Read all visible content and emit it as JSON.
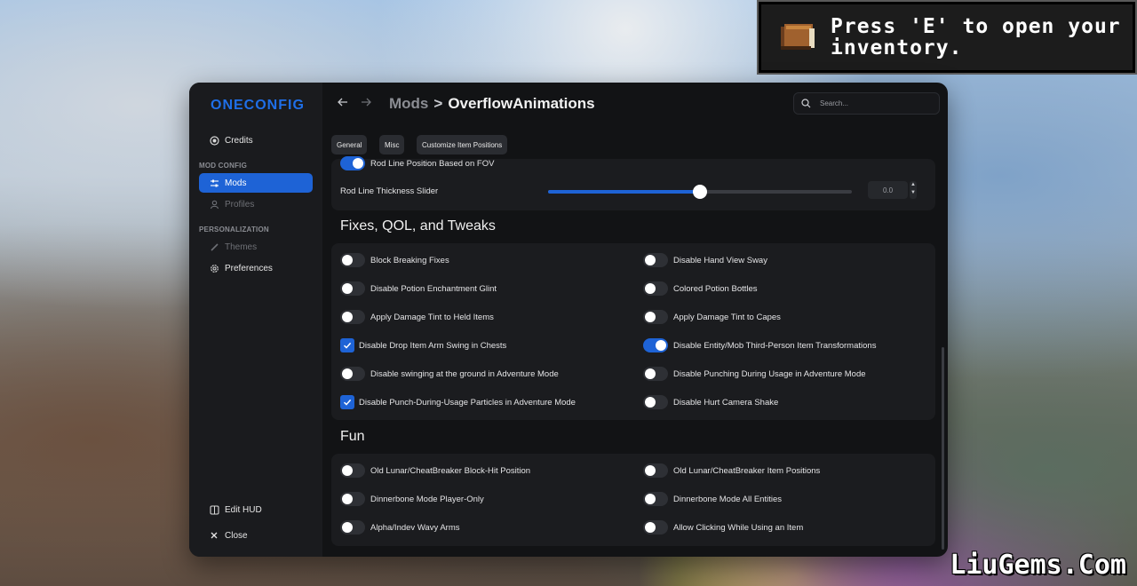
{
  "toast": {
    "message": "Press 'E' to open your inventory."
  },
  "watermark": "LiuGems.Com",
  "sidebar": {
    "logo": "ONECONFIG",
    "credits": "Credits",
    "mod_config_heading": "MOD CONFIG",
    "mods": "Mods",
    "profiles": "Profiles",
    "personalization_heading": "PERSONALIZATION",
    "themes": "Themes",
    "preferences": "Preferences",
    "edit_hud": "Edit HUD",
    "close": "Close"
  },
  "header": {
    "breadcrumb_parent": "Mods",
    "breadcrumb_separator": ">",
    "breadcrumb_current": "OverflowAnimations",
    "search_placeholder": "Search..."
  },
  "tabs": [
    "General",
    "Misc",
    "Customize Item Positions"
  ],
  "top_card": {
    "rod_line_fov": {
      "label": "Rod Line Position Based on FOV",
      "on": true
    },
    "slider": {
      "label": "Rod Line Thickness Slider",
      "value": "0.0",
      "fraction": 0.5
    }
  },
  "sections": {
    "fixes": {
      "title": "Fixes, QOL, and Tweaks",
      "left": [
        {
          "label": "Block Breaking Fixes",
          "control": "toggle",
          "on": false
        },
        {
          "label": "Disable Potion Enchantment Glint",
          "control": "toggle",
          "on": false
        },
        {
          "label": "Apply Damage Tint to Held Items",
          "control": "toggle",
          "on": false
        },
        {
          "label": "Disable Drop Item Arm Swing in Chests",
          "control": "checkbox",
          "on": true
        },
        {
          "label": "Disable swinging at the ground in Adventure Mode",
          "control": "toggle",
          "on": false
        },
        {
          "label": "Disable Punch-During-Usage Particles in Adventure Mode",
          "control": "checkbox",
          "on": true
        }
      ],
      "right": [
        {
          "label": "Disable Hand View Sway",
          "control": "toggle",
          "on": false
        },
        {
          "label": "Colored Potion Bottles",
          "control": "toggle",
          "on": false
        },
        {
          "label": "Apply Damage Tint to Capes",
          "control": "toggle",
          "on": false
        },
        {
          "label": "Disable Entity/Mob Third-Person Item Transformations",
          "control": "toggle",
          "on": true
        },
        {
          "label": "Disable Punching During Usage in Adventure Mode",
          "control": "toggle",
          "on": false
        },
        {
          "label": "Disable Hurt Camera Shake",
          "control": "toggle",
          "on": false
        }
      ]
    },
    "fun": {
      "title": "Fun",
      "left": [
        {
          "label": "Old Lunar/CheatBreaker Block-Hit Position",
          "control": "toggle",
          "on": false
        },
        {
          "label": "Dinnerbone Mode Player-Only",
          "control": "toggle",
          "on": false
        },
        {
          "label": "Alpha/Indev Wavy Arms",
          "control": "toggle",
          "on": false
        }
      ],
      "right": [
        {
          "label": "Old Lunar/CheatBreaker Item Positions",
          "control": "toggle",
          "on": false
        },
        {
          "label": "Dinnerbone Mode All Entities",
          "control": "toggle",
          "on": false
        },
        {
          "label": "Allow Clicking While Using an Item",
          "control": "toggle",
          "on": false
        }
      ]
    }
  },
  "colors": {
    "accent": "#1e63d6",
    "panel": "#121315",
    "card": "#1b1c1f",
    "sidebar": "#1a1b1e"
  }
}
